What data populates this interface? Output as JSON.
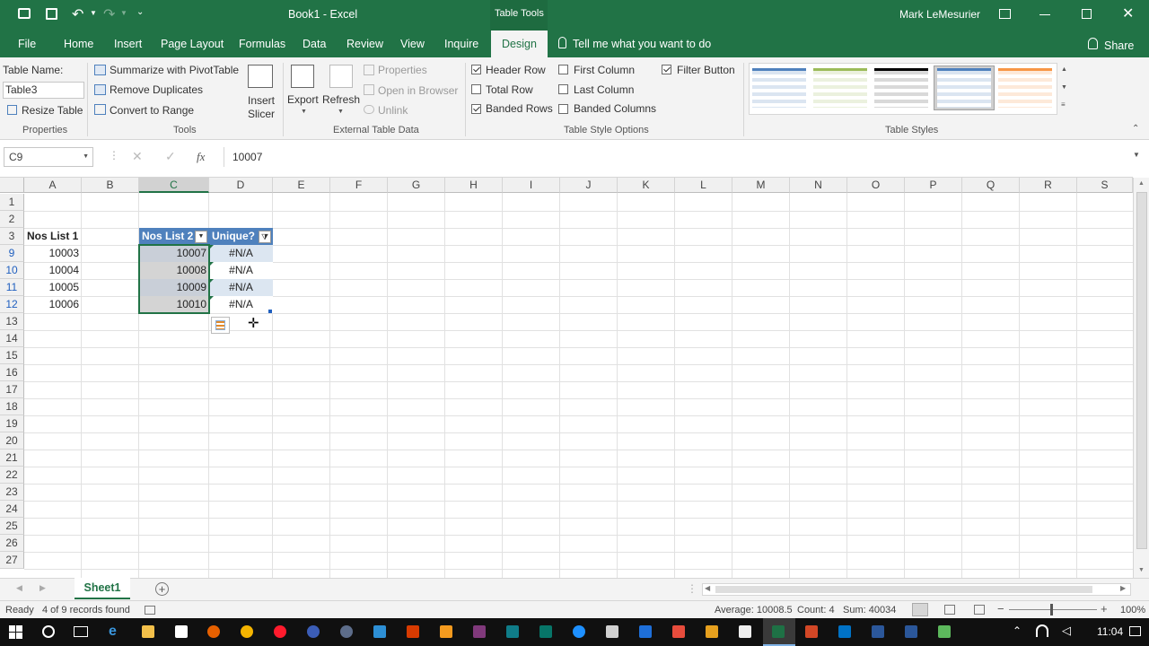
{
  "title_bar": {
    "doc_title": "Book1 - Excel",
    "context_tab": "Table Tools",
    "user": "Mark LeMesurier"
  },
  "tabs": [
    "File",
    "Home",
    "Insert",
    "Page Layout",
    "Formulas",
    "Data",
    "Review",
    "View",
    "Inquire",
    "Design"
  ],
  "tell_me": "Tell me what you want to do",
  "share": "Share",
  "ribbon": {
    "properties": {
      "table_name_label": "Table Name:",
      "table_name_value": "Table3",
      "resize": "Resize Table",
      "group": "Properties"
    },
    "tools": {
      "pivot": "Summarize with PivotTable",
      "remove_dup": "Remove Duplicates",
      "convert": "Convert to Range",
      "slicer_line1": "Insert",
      "slicer_line2": "Slicer",
      "group": "Tools"
    },
    "external": {
      "export": "Export",
      "refresh": "Refresh",
      "properties": "Properties",
      "open_browser": "Open in Browser",
      "unlink": "Unlink",
      "group": "External Table Data"
    },
    "style_options": {
      "header_row": "Header Row",
      "total_row": "Total Row",
      "banded_rows": "Banded Rows",
      "first_column": "First Column",
      "last_column": "Last Column",
      "banded_columns": "Banded Columns",
      "filter_button": "Filter Button",
      "group": "Table Style Options",
      "checked": {
        "header_row": true,
        "total_row": false,
        "banded_rows": true,
        "first_column": false,
        "last_column": false,
        "banded_columns": false,
        "filter_button": true
      }
    },
    "table_styles": {
      "group": "Table Styles",
      "colors": [
        "#4f81bd",
        "#9bbb59",
        "#000000",
        "#4f81bd",
        "#f79646"
      ]
    }
  },
  "formula_bar": {
    "name_box": "C9",
    "fx": "fx",
    "value": "10007"
  },
  "columns": [
    "A",
    "B",
    "C",
    "D",
    "E",
    "F",
    "G",
    "H",
    "I",
    "J",
    "K",
    "L",
    "M",
    "N",
    "O",
    "P",
    "Q",
    "R",
    "S"
  ],
  "rows": [
    "1",
    "2",
    "3",
    "9",
    "10",
    "11",
    "12",
    "13",
    "14",
    "15",
    "16",
    "17",
    "18",
    "19",
    "20",
    "21",
    "22",
    "23",
    "24",
    "25",
    "26",
    "27"
  ],
  "sheet": {
    "a3": "Nos List 1",
    "list1": [
      "10003",
      "10004",
      "10005",
      "10006"
    ],
    "c_header": "Nos List 2",
    "d_header": "Unique?",
    "list2": [
      "10007",
      "10008",
      "10009",
      "10010"
    ],
    "unique": [
      "#N/A",
      "#N/A",
      "#N/A",
      "#N/A"
    ]
  },
  "sheet_tab": "Sheet1",
  "status": {
    "ready": "Ready",
    "records": "4 of 9 records found",
    "average": "Average: 10008.5",
    "count": "Count: 4",
    "sum": "Sum: 40034",
    "zoom": "100%"
  },
  "taskbar": {
    "time": "11:04"
  }
}
